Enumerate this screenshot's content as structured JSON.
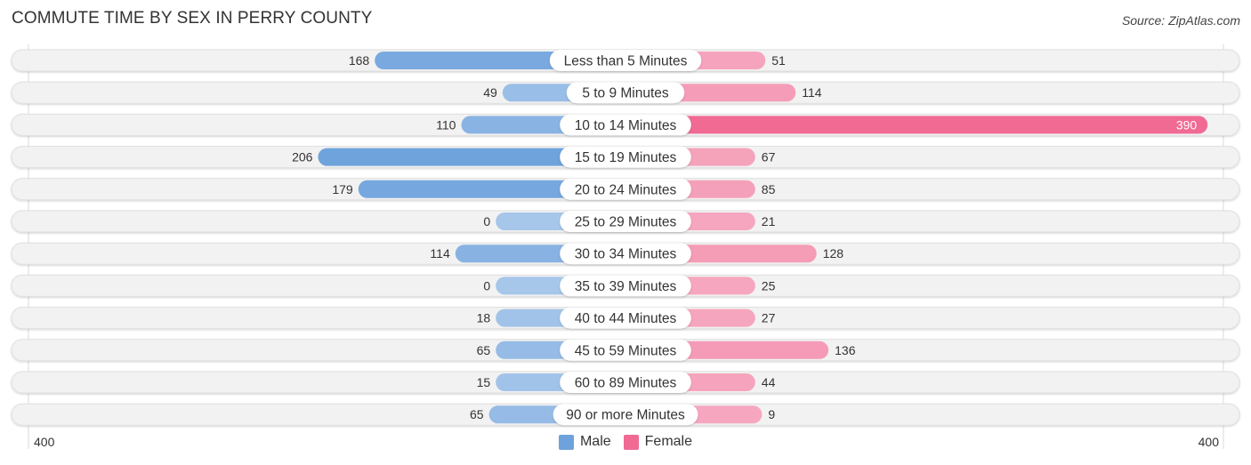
{
  "title": "COMMUTE TIME BY SEX IN PERRY COUNTY",
  "source": "Source: ZipAtlas.com",
  "colors": {
    "male": "#6ea2dc",
    "male_light": "#a6c6ea",
    "female": "#f06a94",
    "female_light": "#f6a8c0",
    "row_bg": "#f2f2f2"
  },
  "chart_data": {
    "type": "bar",
    "orientation": "horizontal-diverging",
    "title": "COMMUTE TIME BY SEX IN PERRY COUNTY",
    "categories": [
      "Less than 5 Minutes",
      "5 to 9 Minutes",
      "10 to 14 Minutes",
      "15 to 19 Minutes",
      "20 to 24 Minutes",
      "25 to 29 Minutes",
      "30 to 34 Minutes",
      "35 to 39 Minutes",
      "40 to 44 Minutes",
      "45 to 59 Minutes",
      "60 to 89 Minutes",
      "90 or more Minutes"
    ],
    "series": [
      {
        "name": "Male",
        "values": [
          168,
          49,
          110,
          206,
          179,
          0,
          114,
          0,
          18,
          65,
          15,
          65
        ]
      },
      {
        "name": "Female",
        "values": [
          51,
          114,
          390,
          67,
          85,
          21,
          128,
          25,
          27,
          136,
          44,
          9
        ]
      }
    ],
    "xlim": [
      -400,
      400
    ],
    "axis_labels": {
      "left": "400",
      "right": "400"
    },
    "legend": {
      "placement": "bottom-center",
      "entries": [
        "Male",
        "Female"
      ]
    },
    "grid": false
  }
}
